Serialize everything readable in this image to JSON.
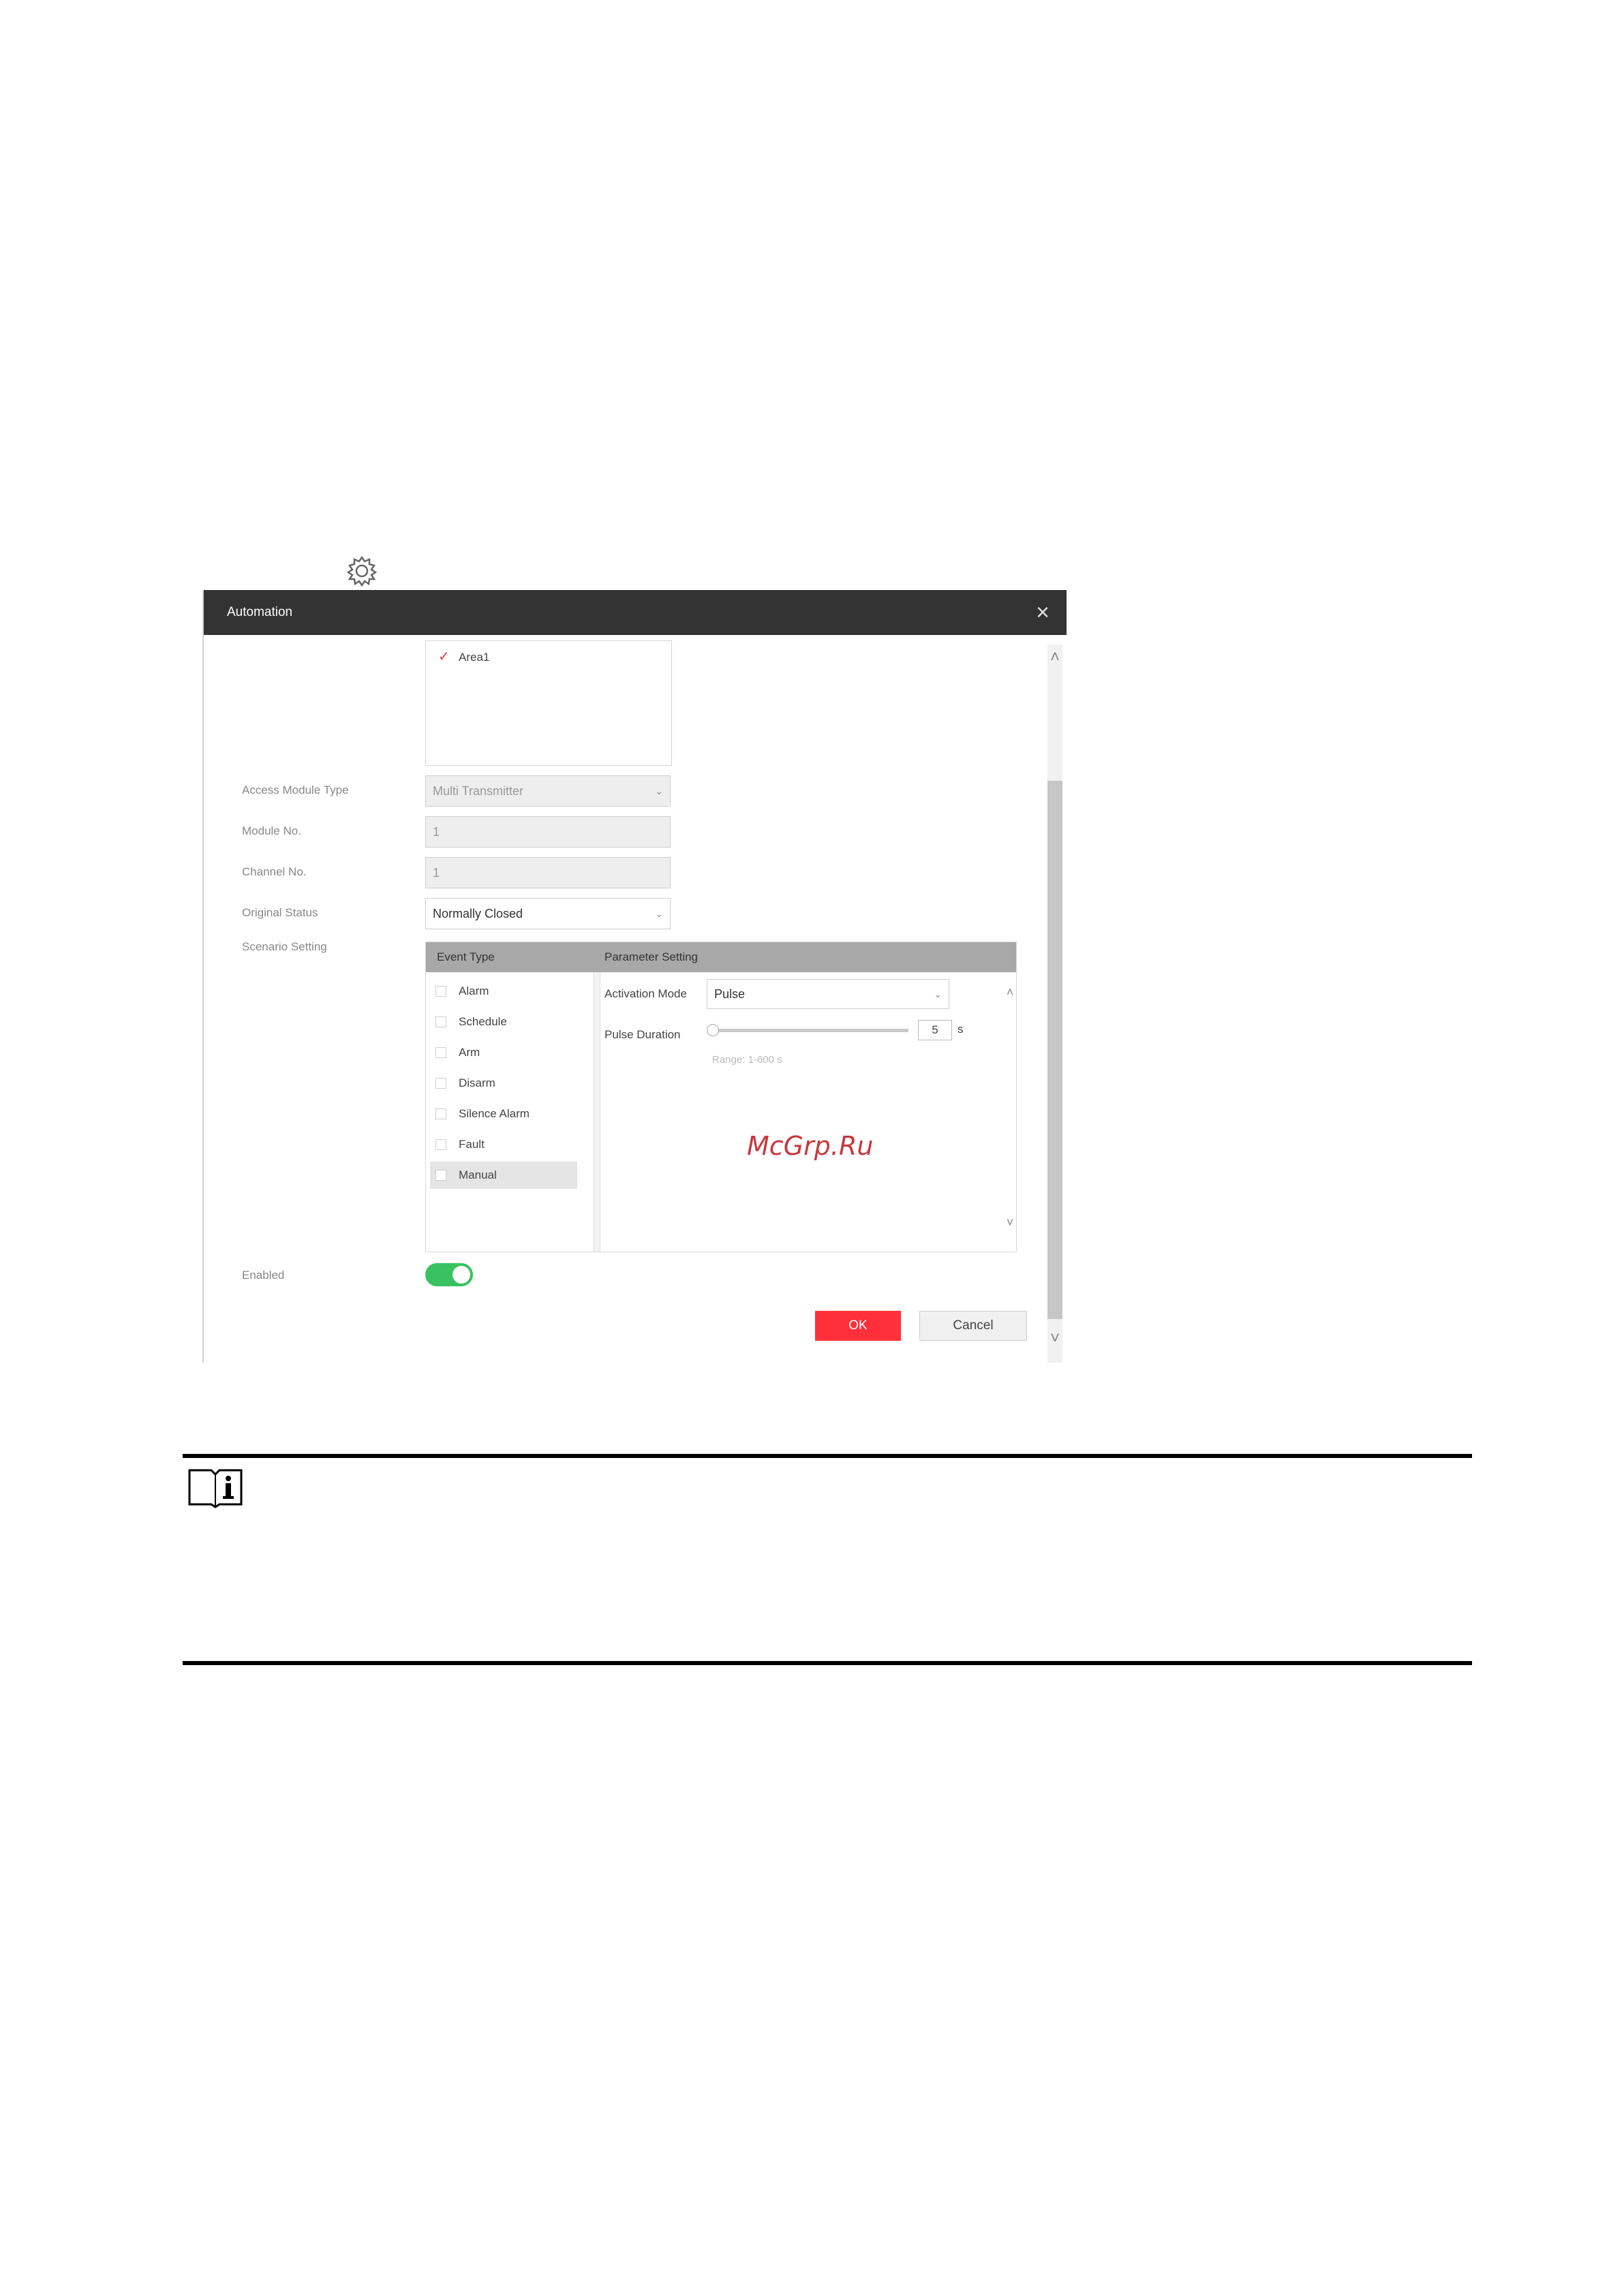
{
  "dialog": {
    "title": "Automation",
    "close_icon": "close-icon",
    "area_item": "Area1",
    "fields": {
      "access_module_type": {
        "label": "Access Module Type",
        "value": "Multi Transmitter"
      },
      "module_no": {
        "label": "Module No.",
        "value": "1"
      },
      "channel_no": {
        "label": "Channel No.",
        "value": "1"
      },
      "original_status": {
        "label": "Original Status",
        "value": "Normally Closed"
      },
      "scenario_setting": {
        "label": "Scenario Setting"
      }
    },
    "scenario": {
      "event_type_header": "Event Type",
      "parameter_header": "Parameter Setting",
      "events": [
        "Alarm",
        "Schedule",
        "Arm",
        "Disarm",
        "Silence Alarm",
        "Fault",
        "Manual"
      ],
      "selected_event": "Manual",
      "activation_mode_label": "Activation Mode",
      "activation_mode_value": "Pulse",
      "pulse_duration_label": "Pulse Duration",
      "pulse_duration_value": "5",
      "pulse_duration_unit": "s",
      "pulse_range_hint": "Range: 1-600 s"
    },
    "enabled_label": "Enabled",
    "enabled": true,
    "ok_label": "OK",
    "cancel_label": "Cancel"
  },
  "watermark": "McGrp.Ru",
  "colors": {
    "titlebar": "#333333",
    "ok": "#ff303a",
    "toggle_on": "#3ac260",
    "area_check": "#e8393f"
  }
}
